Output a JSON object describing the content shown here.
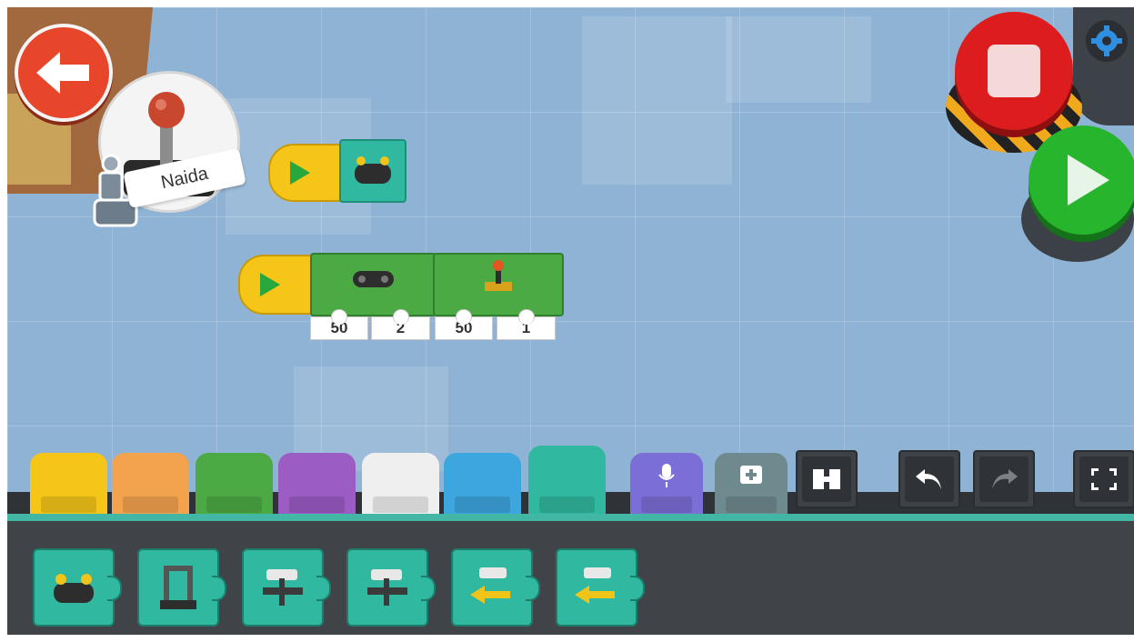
{
  "robot": {
    "name": "Naida"
  },
  "program": {
    "blocks": [
      {
        "param_a": "50",
        "param_b": "2"
      },
      {
        "param_a": "50",
        "param_b": "1"
      }
    ]
  },
  "icons": {
    "back": "back-arrow-icon",
    "stop": "stop-icon",
    "play": "play-icon",
    "settings": "gear-icon",
    "undo": "undo-icon",
    "redo": "redo-icon",
    "fullscreen": "fullscreen-icon",
    "microphone": "microphone-icon",
    "add_block": "add-block-icon",
    "blocks_view": "blocks-view-icon"
  },
  "category_tabs": [
    {
      "color": "#f5c518"
    },
    {
      "color": "#f3a24e"
    },
    {
      "color": "#4caa44"
    },
    {
      "color": "#9b5cc4"
    },
    {
      "color": "#efefef"
    },
    {
      "color": "#3ea6de"
    },
    {
      "color": "#31b8a0"
    },
    {
      "color": "#7b6ed6"
    },
    {
      "color": "#6f8a8e"
    }
  ],
  "palette": [
    {
      "icon": "remote-control-icon"
    },
    {
      "icon": "gate-icon"
    },
    {
      "icon": "motor-plane-icon"
    },
    {
      "icon": "motor-plane-icon"
    },
    {
      "icon": "motor-plane-arrow-icon"
    },
    {
      "icon": "motor-plane-arrow-icon"
    }
  ],
  "colors": {
    "accent_teal": "#31b8a0",
    "workspace": "#8fb3d4",
    "stop_red": "#dd1d1d",
    "run_green": "#27b52e"
  }
}
